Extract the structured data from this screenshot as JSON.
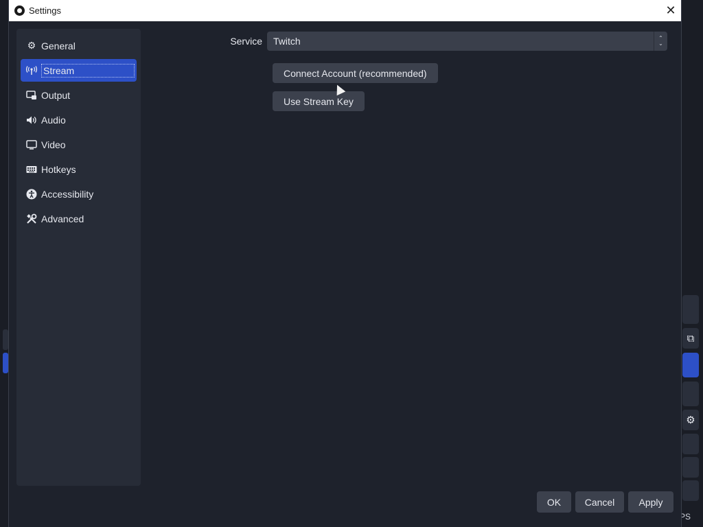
{
  "window": {
    "title": "Settings"
  },
  "sidebar": {
    "items": [
      {
        "label": "General",
        "icon": "gear-icon"
      },
      {
        "label": "Stream",
        "icon": "antenna-icon",
        "active": true
      },
      {
        "label": "Output",
        "icon": "output-icon"
      },
      {
        "label": "Audio",
        "icon": "speaker-icon"
      },
      {
        "label": "Video",
        "icon": "monitor-icon"
      },
      {
        "label": "Hotkeys",
        "icon": "keyboard-icon"
      },
      {
        "label": "Accessibility",
        "icon": "accessibility-icon"
      },
      {
        "label": "Advanced",
        "icon": "tools-icon"
      }
    ]
  },
  "stream": {
    "service_label": "Service",
    "service_value": "Twitch",
    "connect_button": "Connect Account (recommended)",
    "stream_key_button": "Use Stream Key"
  },
  "footer": {
    "ok": "OK",
    "cancel": "Cancel",
    "apply": "Apply"
  },
  "background": {
    "status_text": "PS"
  },
  "colors": {
    "accent": "#2d50c7",
    "dialog_bg": "#1e222c",
    "sidebar_bg": "#272c37",
    "button_bg": "#3c414d"
  }
}
